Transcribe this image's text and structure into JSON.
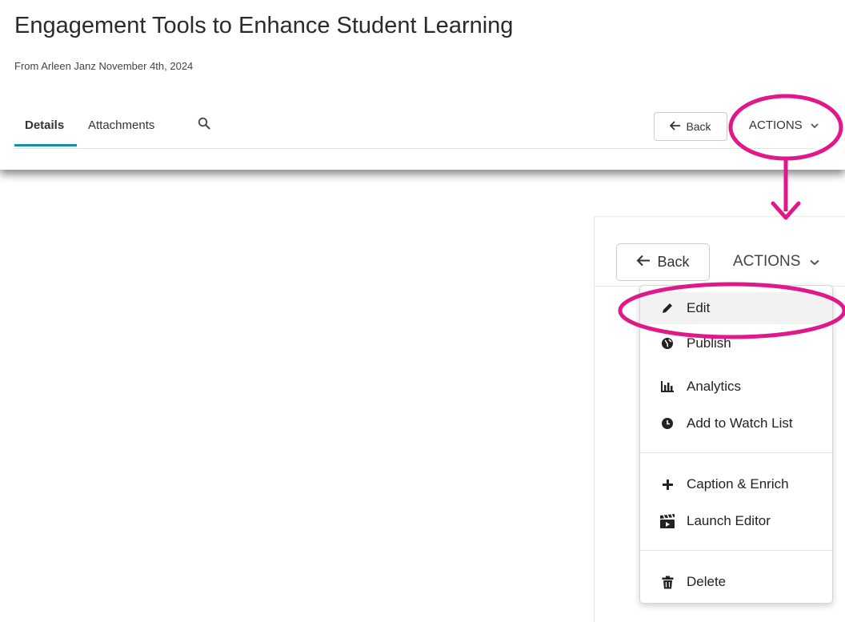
{
  "page": {
    "title": "Engagement Tools to Enhance Student Learning",
    "subtitle": "From Arleen Janz November 4th, 2024"
  },
  "tabs": [
    {
      "label": "Details",
      "active": true
    },
    {
      "label": "Attachments",
      "active": false
    }
  ],
  "toolbar": {
    "back_label": "Back",
    "actions_label": "ACTIONS"
  },
  "menu": {
    "items": [
      {
        "label": "Edit",
        "icon": "pencil-icon"
      },
      {
        "label": "Publish",
        "icon": "globe-icon"
      },
      {
        "label": "Analytics",
        "icon": "bar-chart-icon"
      },
      {
        "label": "Add to Watch List",
        "icon": "clock-icon"
      },
      {
        "label": "Caption & Enrich",
        "icon": "plus-icon"
      },
      {
        "label": "Launch Editor",
        "icon": "clapperboard-icon"
      },
      {
        "label": "Delete",
        "icon": "trash-icon"
      }
    ]
  },
  "colors": {
    "accent_underline": "#1a8fa3",
    "annotation": "#e0198a"
  }
}
